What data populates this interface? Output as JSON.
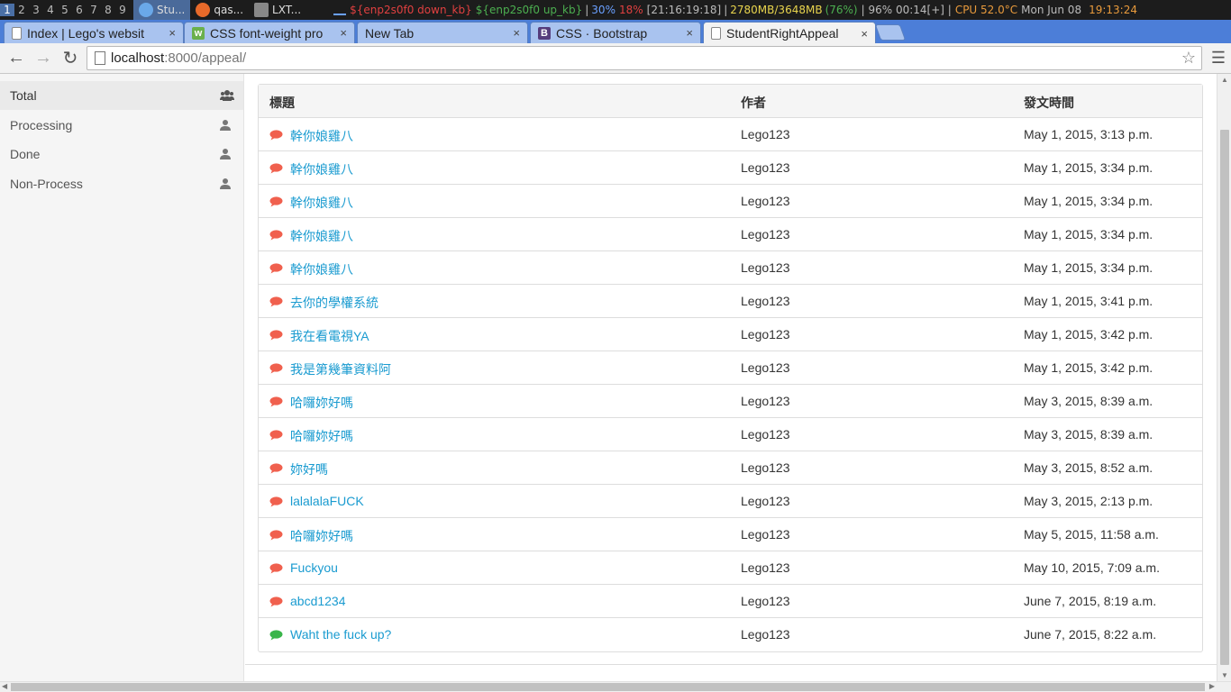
{
  "sysbar": {
    "workspaces": [
      "1",
      "2",
      "3",
      "4",
      "5",
      "6",
      "7",
      "8",
      "9"
    ],
    "tasks": [
      {
        "label": "Stu...",
        "active": true,
        "icon": "chromium-icon"
      },
      {
        "label": "qas...",
        "active": false,
        "icon": "firefox-icon"
      },
      {
        "label": "LXT...",
        "active": false,
        "icon": "terminal-icon"
      }
    ],
    "status": {
      "net": "${enp2s0f0 down_kb}",
      "net_up": "${enp2s0f0 up_kb}",
      "volume": "30%",
      "vol2": "18%",
      "clock1": "[21:16:19:18]",
      "mem": "2780MB/3648MB",
      "mem_pct": "(76%)",
      "battery": "| 96% 00:14[+] |",
      "cpu": "CPU 52.0°C",
      "date": "Mon Jun 08",
      "time": "19:13:24"
    }
  },
  "tabs": [
    {
      "title": "Index | Lego's websit",
      "favicon": "page-icon",
      "active": false
    },
    {
      "title": "CSS font-weight pro",
      "favicon": "w3-icon",
      "active": false
    },
    {
      "title": "New Tab",
      "favicon": "",
      "active": false
    },
    {
      "title": "CSS · Bootstrap",
      "favicon": "bootstrap-icon",
      "active": false
    },
    {
      "title": "StudentRightAppeal",
      "favicon": "page-icon",
      "active": true
    }
  ],
  "tab_close": "×",
  "omnibox": {
    "host": "localhost",
    "path": ":8000/appeal/"
  },
  "sidebar": {
    "items": [
      {
        "label": "Total",
        "icon": "users-icon",
        "active": true
      },
      {
        "label": "Processing",
        "icon": "user-icon",
        "active": false
      },
      {
        "label": "Done",
        "icon": "user-icon",
        "active": false
      },
      {
        "label": "Non-Process",
        "icon": "user-icon",
        "active": false
      }
    ]
  },
  "table": {
    "headers": {
      "title": "標題",
      "author": "作者",
      "time": "發文時間"
    },
    "rows": [
      {
        "title": "幹你娘雞八",
        "author": "Lego123",
        "time": "May 1, 2015, 3:13 p.m.",
        "status": "red"
      },
      {
        "title": "幹你娘雞八",
        "author": "Lego123",
        "time": "May 1, 2015, 3:34 p.m.",
        "status": "red"
      },
      {
        "title": "幹你娘雞八",
        "author": "Lego123",
        "time": "May 1, 2015, 3:34 p.m.",
        "status": "red"
      },
      {
        "title": "幹你娘雞八",
        "author": "Lego123",
        "time": "May 1, 2015, 3:34 p.m.",
        "status": "red"
      },
      {
        "title": "幹你娘雞八",
        "author": "Lego123",
        "time": "May 1, 2015, 3:34 p.m.",
        "status": "red"
      },
      {
        "title": "去你的學權系統",
        "author": "Lego123",
        "time": "May 1, 2015, 3:41 p.m.",
        "status": "red"
      },
      {
        "title": "我在看電視YA",
        "author": "Lego123",
        "time": "May 1, 2015, 3:42 p.m.",
        "status": "red"
      },
      {
        "title": "我是第幾筆資料阿",
        "author": "Lego123",
        "time": "May 1, 2015, 3:42 p.m.",
        "status": "red"
      },
      {
        "title": "哈囉妳好嗎",
        "author": "Lego123",
        "time": "May 3, 2015, 8:39 a.m.",
        "status": "red"
      },
      {
        "title": "哈囉妳好嗎",
        "author": "Lego123",
        "time": "May 3, 2015, 8:39 a.m.",
        "status": "red"
      },
      {
        "title": "妳好嗎",
        "author": "Lego123",
        "time": "May 3, 2015, 8:52 a.m.",
        "status": "red"
      },
      {
        "title": "lalalalaFUCK",
        "author": "Lego123",
        "time": "May 3, 2015, 2:13 p.m.",
        "status": "red"
      },
      {
        "title": "哈囉妳好嗎",
        "author": "Lego123",
        "time": "May 5, 2015, 11:58 a.m.",
        "status": "red"
      },
      {
        "title": "Fuckyou",
        "author": "Lego123",
        "time": "May 10, 2015, 7:09 a.m.",
        "status": "red"
      },
      {
        "title": "abcd1234",
        "author": "Lego123",
        "time": "June 7, 2015, 8:19 a.m.",
        "status": "red"
      },
      {
        "title": "Waht the fuck up?",
        "author": "Lego123",
        "time": "June 7, 2015, 8:22 a.m.",
        "status": "green"
      }
    ]
  },
  "colors": {
    "red": "#f0604e",
    "green": "#3ab54a",
    "link": "#1a9bd0",
    "tabstrip": "#4c7ed8"
  }
}
